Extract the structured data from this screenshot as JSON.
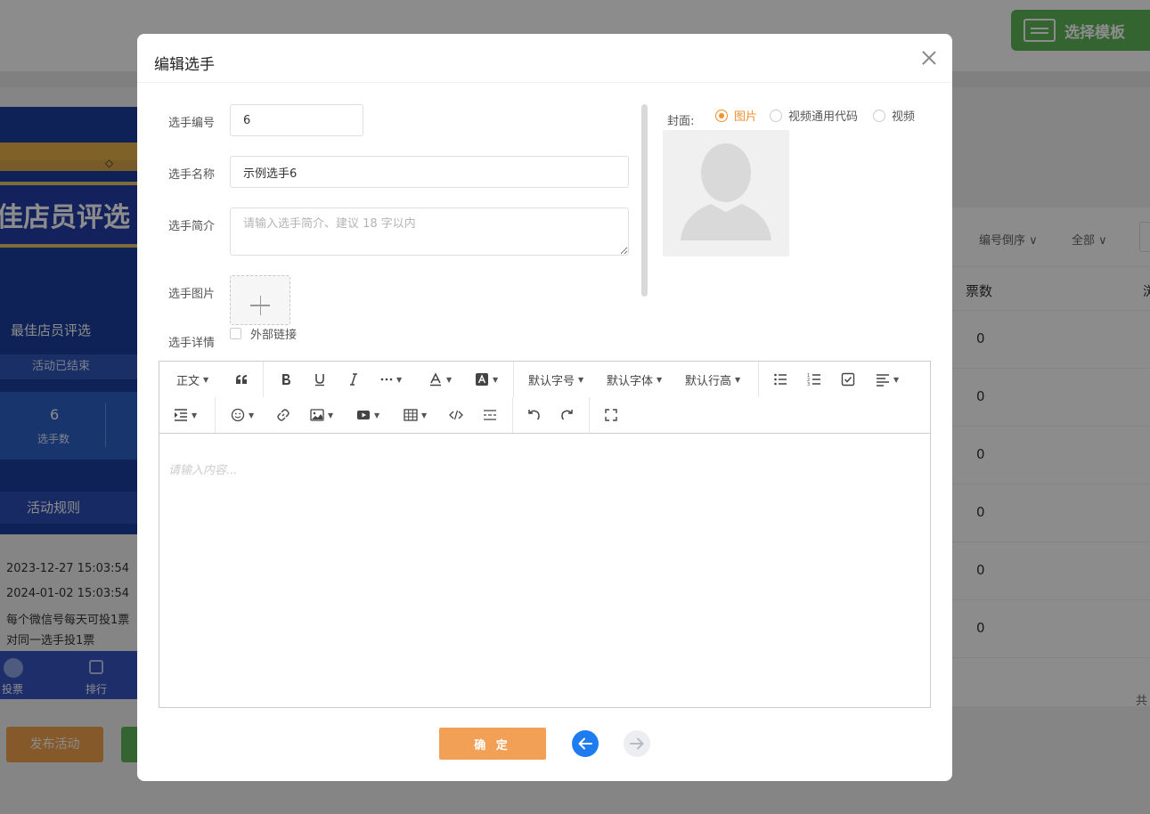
{
  "background": {
    "template_button": "选择模板",
    "phone": {
      "big_title": "佳店员评选",
      "subtitle": "最佳店员评选",
      "status": "活动已结束",
      "stat_value": "6",
      "stat_label": "选手数",
      "rules": "活动规则"
    },
    "info": {
      "start_time": "2023-12-27 15:03:54",
      "end_time": "2024-01-02 15:03:54",
      "rule_line1": "每个微信号每天可投1票",
      "rule_line2": "对同一选手投1票"
    },
    "tabbar": {
      "vote": "投票",
      "rank": "排行"
    },
    "publish_button": "发布活动",
    "filters": {
      "sort": "编号倒序",
      "all": "全部"
    },
    "table": {
      "col_votes": "票数",
      "col_partial": "浏",
      "votes": [
        "0",
        "0",
        "0",
        "0",
        "0",
        "0"
      ],
      "total_partial": "共"
    }
  },
  "dialog": {
    "title": "编辑选手",
    "fields": {
      "number_label": "选手编号",
      "number_value": "6",
      "name_label": "选手名称",
      "name_value": "示例选手6",
      "intro_label": "选手简介",
      "intro_placeholder": "请输入选手简介、建议 18 字以内",
      "image_label": "选手图片",
      "detail_label": "选手详情",
      "external_link": "外部链接"
    },
    "cover": {
      "label": "封面:",
      "options": [
        "图片",
        "视频通用代码",
        "视频"
      ],
      "selected": "图片"
    },
    "editor": {
      "toolbar": {
        "paragraph": "正文",
        "font_size": "默认字号",
        "font_family": "默认字体",
        "line_height": "默认行高"
      },
      "placeholder": "请输入内容..."
    },
    "confirm_button": "确 定"
  },
  "colors": {
    "accent_orange": "#f3a057",
    "radio_orange": "#f0902e",
    "nav_blue": "#1e7cf0",
    "template_green": "#5fb85a"
  }
}
